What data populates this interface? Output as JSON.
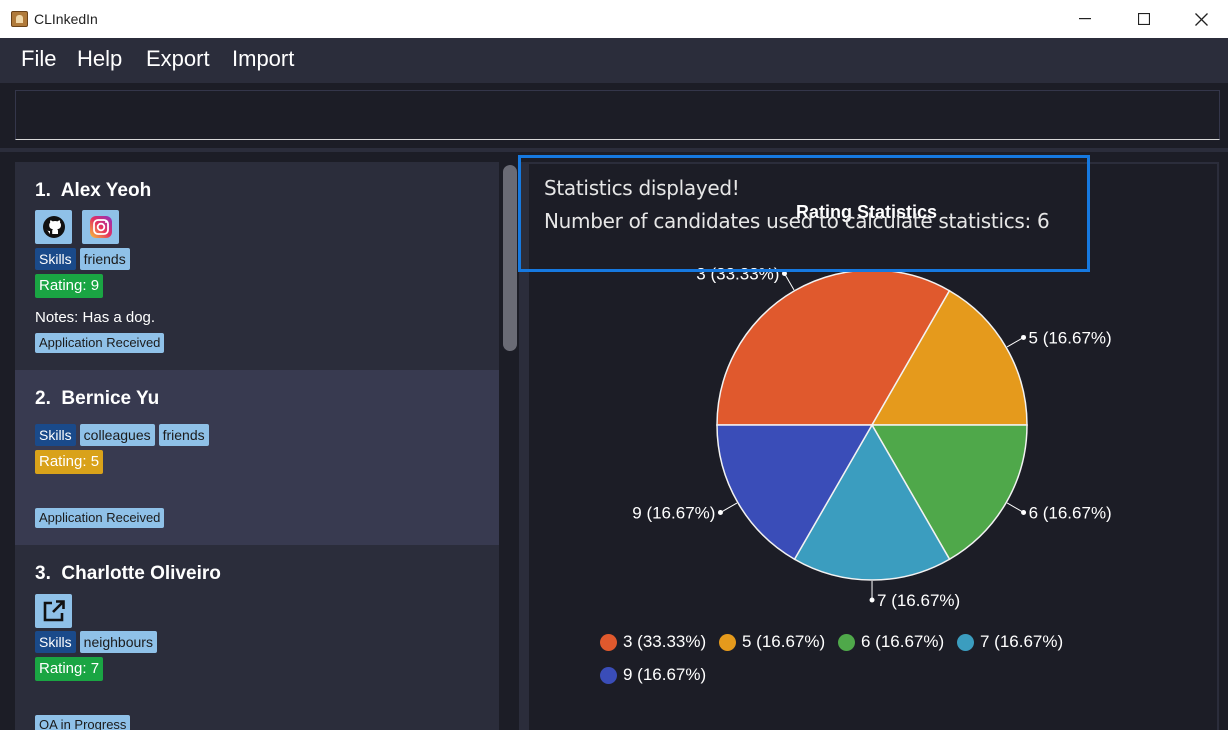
{
  "window": {
    "title": "CLInkedIn"
  },
  "menu": {
    "file": "File",
    "help": "Help",
    "export": "Export",
    "import": "Import"
  },
  "command": {
    "value": ""
  },
  "persons": [
    {
      "index": "1.",
      "name": "Alex Yeoh",
      "links": [
        "github-icon",
        "instagram-icon"
      ],
      "tags": [
        "Skills",
        "friends"
      ],
      "rating": "Rating: 9",
      "rating_color": "#1aa543",
      "notes": "Notes: Has a dog.",
      "status": "Application Received"
    },
    {
      "index": "2.",
      "name": "Bernice Yu",
      "links": [],
      "tags": [
        "Skills",
        "colleagues",
        "friends"
      ],
      "rating": "Rating: 5",
      "rating_color": "#d9a21a",
      "notes": "",
      "status": "Application Received"
    },
    {
      "index": "3.",
      "name": "Charlotte Oliveiro",
      "links": [
        "external-link-icon"
      ],
      "tags": [
        "Skills",
        "neighbours"
      ],
      "rating": "Rating: 7",
      "rating_color": "#1aa543",
      "notes": "",
      "status": "OA in Progress"
    }
  ],
  "result": {
    "line1": "Statistics displayed!",
    "line2": "Number of candidates used to calculate statistics: 6"
  },
  "chart_data": {
    "type": "pie",
    "title": "Rating Statistics",
    "slices": [
      {
        "label": "3 (33.33%)",
        "value": 33.33,
        "color": "#e0592d"
      },
      {
        "label": "5 (16.67%)",
        "value": 16.67,
        "color": "#e59a1c"
      },
      {
        "label": "6 (16.67%)",
        "value": 16.67,
        "color": "#4fa84a"
      },
      {
        "label": "7 (16.67%)",
        "value": 16.67,
        "color": "#3b9dbf"
      },
      {
        "label": "9 (16.67%)",
        "value": 16.67,
        "color": "#3a4db8"
      }
    ],
    "legend_position": "bottom"
  }
}
